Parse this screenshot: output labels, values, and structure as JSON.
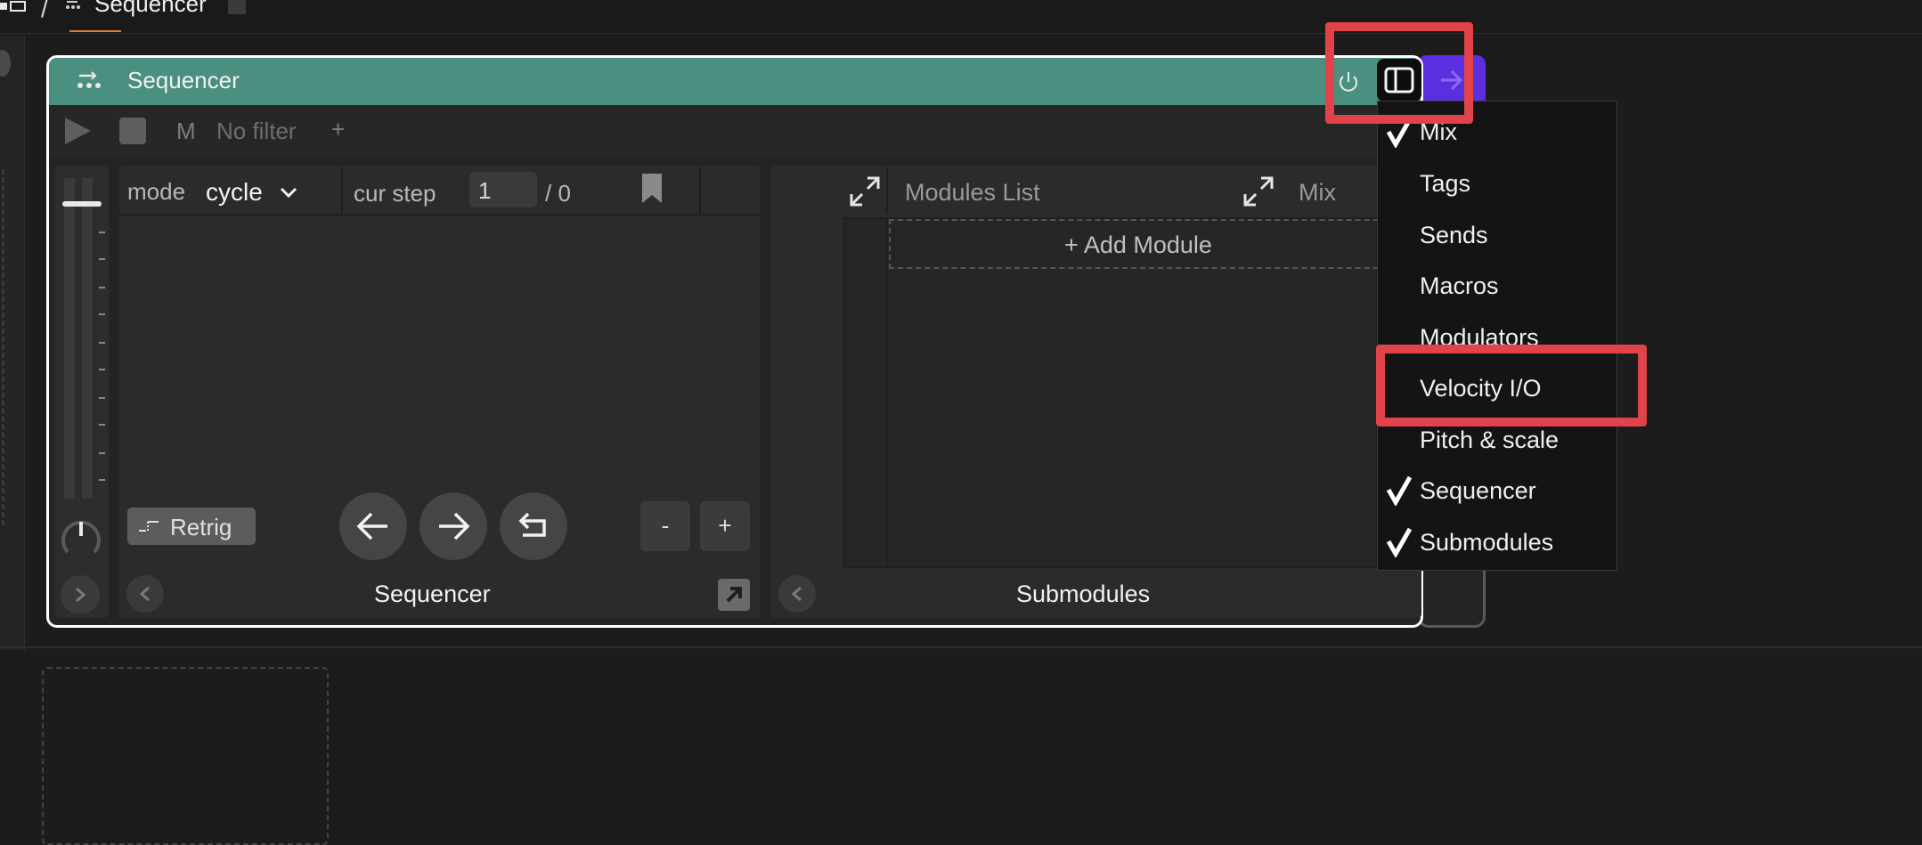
{
  "breadcrumb": {
    "separator": "/",
    "current": "Sequencer"
  },
  "device": {
    "title": "Sequencer",
    "header_color": "#4a8f7f",
    "side_color": "#5b2fe0",
    "toolbar": {
      "m_label": "M",
      "filter_label": "No filter",
      "filter_add": "+"
    }
  },
  "sequencer": {
    "mode_label": "mode",
    "mode_value": "cycle",
    "cur_step_label": "cur step",
    "cur_step_value": "1",
    "cur_step_total": "/ 0",
    "retrig_label": "Retrig",
    "minus_label": "-",
    "plus_label": "+",
    "footer_label": "Sequencer"
  },
  "submodules": {
    "modules_list_label": "Modules List",
    "mix_label": "Mix",
    "add_module_label": "+ Add Module",
    "footer_label": "Submodules"
  },
  "menu": {
    "items": [
      {
        "label": "Mix",
        "checked": true
      },
      {
        "label": "Tags",
        "checked": false
      },
      {
        "label": "Sends",
        "checked": false
      },
      {
        "label": "Macros",
        "checked": false
      },
      {
        "label": "Modulators",
        "checked": false
      },
      {
        "label": "Velocity I/O",
        "checked": false
      },
      {
        "label": "Pitch & scale",
        "checked": false
      },
      {
        "label": "Sequencer",
        "checked": true
      },
      {
        "label": "Submodules",
        "checked": true
      }
    ]
  },
  "highlight_color": "#e0444a",
  "accent_color": "#e07a2f"
}
